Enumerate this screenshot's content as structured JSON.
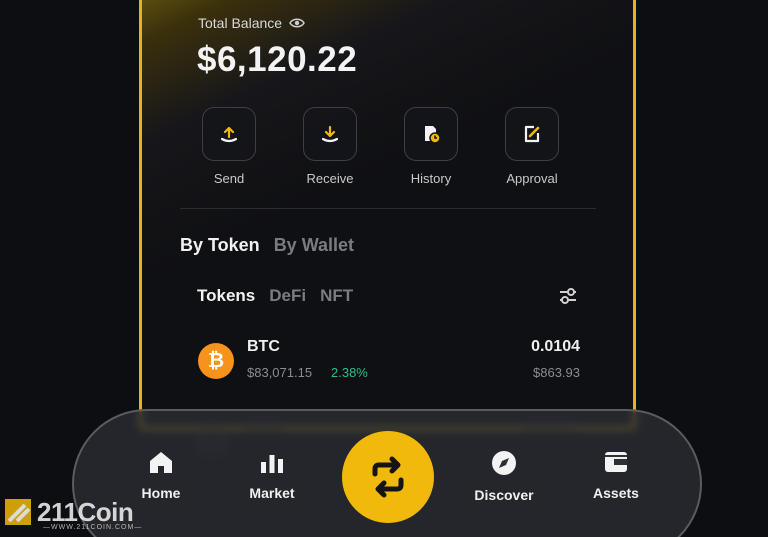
{
  "balance": {
    "label": "Total Balance",
    "value": "$6,120.22"
  },
  "actions": [
    {
      "label": "Send",
      "icon": "send-icon"
    },
    {
      "label": "Receive",
      "icon": "receive-icon"
    },
    {
      "label": "History",
      "icon": "history-icon"
    },
    {
      "label": "Approval",
      "icon": "approval-icon"
    }
  ],
  "view_tabs": [
    {
      "label": "By Token",
      "active": true
    },
    {
      "label": "By Wallet",
      "active": false
    }
  ],
  "asset_tabs": [
    {
      "label": "Tokens",
      "active": true
    },
    {
      "label": "DeFi",
      "active": false
    },
    {
      "label": "NFT",
      "active": false
    }
  ],
  "tokens": [
    {
      "symbol": "BTC",
      "price": "$83,071.15",
      "change": "2.38%",
      "amount": "0.0104",
      "value": "$863.93"
    }
  ],
  "nav": {
    "items": [
      {
        "label": "Home",
        "icon": "home-icon"
      },
      {
        "label": "Market",
        "icon": "market-icon"
      },
      {
        "label": "Discover",
        "icon": "compass-icon"
      },
      {
        "label": "Assets",
        "icon": "wallet-icon"
      }
    ],
    "center_icon": "swap-icon"
  },
  "watermark": {
    "text": "211Coin",
    "subtext": "—WWW.211COIN.COM—"
  },
  "colors": {
    "accent": "#f0b90b",
    "positive": "#2ebd85",
    "btc": "#f7931a",
    "background": "#0d0e11"
  }
}
